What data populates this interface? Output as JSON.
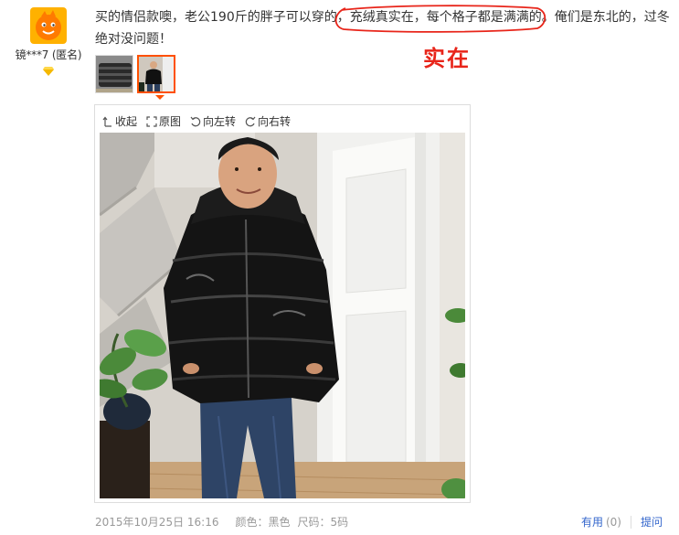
{
  "reviewer": {
    "name": "镜***7 (匿名)",
    "avatar_icon": "orange-cartoon-avatar-icon",
    "level_icon": "gold-diamond-icon"
  },
  "review": {
    "text_before": "买的情侣款噢，老公190斤的胖子可以穿的，",
    "text_circled": "充绒真实在，每个格子都是满满的。",
    "text_after": "俺们是东北的，过冬绝对没问题！",
    "annotation": "实在",
    "annotation_color": "#e8251a"
  },
  "thumbnails": [
    {
      "name": "photo-1",
      "active": false
    },
    {
      "name": "photo-2",
      "active": true
    }
  ],
  "viewer": {
    "collapse_label": "收起",
    "original_label": "原图",
    "rotate_left_label": "向左转",
    "rotate_right_label": "向右转"
  },
  "meta": {
    "date": "2015年10月25日 16:16",
    "color_label": "颜色：黑色",
    "size_label": "尺码：5码"
  },
  "actions": {
    "useful_label": "有用",
    "useful_count": "(0)",
    "ask_label": "提问"
  },
  "colors": {
    "accent": "#ff5000",
    "link": "#3366cc",
    "muted": "#999999"
  }
}
